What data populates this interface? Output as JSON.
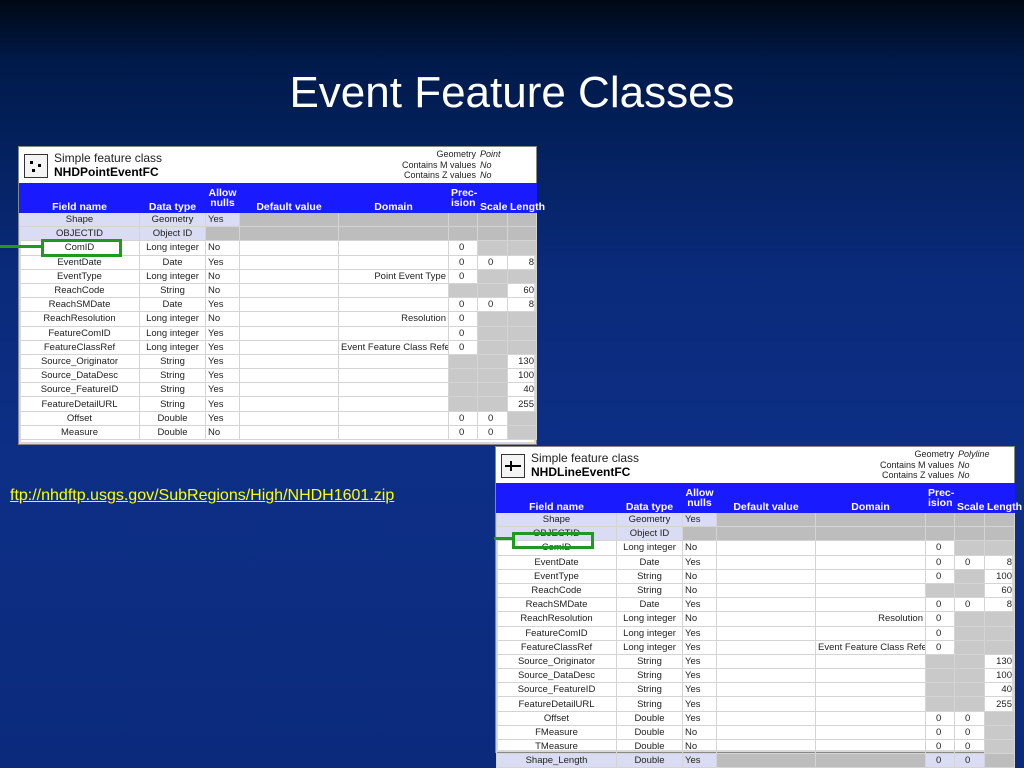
{
  "slide": {
    "title": "Event Feature Classes",
    "link": "ftp://nhdftp.usgs.gov/SubRegions/High/NHDH1601.zip"
  },
  "columns": [
    "Field name",
    "Data type",
    "Allow nulls",
    "Default value",
    "Domain",
    "Prec-ision",
    "Scale",
    "Length"
  ],
  "columns_display": {
    "field": "Field name",
    "type": "Data type",
    "nulls1": "Allow",
    "nulls2": "nulls",
    "default": "Default value",
    "domain": "Domain",
    "prec1": "Prec-",
    "prec2": "ision",
    "scale": "Scale",
    "length": "Length"
  },
  "point_fc": {
    "kind": "Simple feature class",
    "name": "NHDPointEventFC",
    "meta": [
      {
        "key": "Geometry",
        "value": "Point"
      },
      {
        "key": "Contains M values",
        "value": "No"
      },
      {
        "key": "Contains Z values",
        "value": "No"
      }
    ],
    "rows": [
      {
        "field": "Shape",
        "type": "Geometry",
        "nulls": "Yes",
        "default": "",
        "domain": "",
        "precision": "",
        "scale": "",
        "length": "",
        "sys": true
      },
      {
        "field": "OBJECTID",
        "type": "Object ID",
        "nulls": "",
        "default": "",
        "domain": "",
        "precision": "",
        "scale": "",
        "length": "",
        "sys": true
      },
      {
        "field": "ComID",
        "type": "Long integer",
        "nulls": "No",
        "default": "",
        "domain": "",
        "precision": "0",
        "scale": "",
        "length": ""
      },
      {
        "field": "EventDate",
        "type": "Date",
        "nulls": "Yes",
        "default": "",
        "domain": "",
        "precision": "0",
        "scale": "0",
        "length": "8"
      },
      {
        "field": "EventType",
        "type": "Long integer",
        "nulls": "No",
        "default": "",
        "domain": "Point Event Type",
        "precision": "0",
        "scale": "",
        "length": ""
      },
      {
        "field": "ReachCode",
        "type": "String",
        "nulls": "No",
        "default": "",
        "domain": "",
        "precision": "",
        "scale": "",
        "length": "60"
      },
      {
        "field": "ReachSMDate",
        "type": "Date",
        "nulls": "Yes",
        "default": "",
        "domain": "",
        "precision": "0",
        "scale": "0",
        "length": "8"
      },
      {
        "field": "ReachResolution",
        "type": "Long integer",
        "nulls": "No",
        "default": "",
        "domain": "Resolution",
        "precision": "0",
        "scale": "",
        "length": ""
      },
      {
        "field": "FeatureComID",
        "type": "Long integer",
        "nulls": "Yes",
        "default": "",
        "domain": "",
        "precision": "0",
        "scale": "",
        "length": ""
      },
      {
        "field": "FeatureClassRef",
        "type": "Long integer",
        "nulls": "Yes",
        "default": "",
        "domain": "Event Feature Class Reference",
        "precision": "0",
        "scale": "",
        "length": ""
      },
      {
        "field": "Source_Originator",
        "type": "String",
        "nulls": "Yes",
        "default": "",
        "domain": "",
        "precision": "",
        "scale": "",
        "length": "130"
      },
      {
        "field": "Source_DataDesc",
        "type": "String",
        "nulls": "Yes",
        "default": "",
        "domain": "",
        "precision": "",
        "scale": "",
        "length": "100"
      },
      {
        "field": "Source_FeatureID",
        "type": "String",
        "nulls": "Yes",
        "default": "",
        "domain": "",
        "precision": "",
        "scale": "",
        "length": "40"
      },
      {
        "field": "FeatureDetailURL",
        "type": "String",
        "nulls": "Yes",
        "default": "",
        "domain": "",
        "precision": "",
        "scale": "",
        "length": "255"
      },
      {
        "field": "Offset",
        "type": "Double",
        "nulls": "Yes",
        "default": "",
        "domain": "",
        "precision": "0",
        "scale": "0",
        "length": ""
      },
      {
        "field": "Measure",
        "type": "Double",
        "nulls": "No",
        "default": "",
        "domain": "",
        "precision": "0",
        "scale": "0",
        "length": ""
      }
    ]
  },
  "line_fc": {
    "kind": "Simple feature class",
    "name": "NHDLineEventFC",
    "meta": [
      {
        "key": "Geometry",
        "value": "Polyline"
      },
      {
        "key": "Contains M values",
        "value": "No"
      },
      {
        "key": "Contains Z values",
        "value": "No"
      }
    ],
    "rows": [
      {
        "field": "Shape",
        "type": "Geometry",
        "nulls": "Yes",
        "default": "",
        "domain": "",
        "precision": "",
        "scale": "",
        "length": "",
        "sys": true
      },
      {
        "field": "OBJECTID",
        "type": "Object ID",
        "nulls": "",
        "default": "",
        "domain": "",
        "precision": "",
        "scale": "",
        "length": "",
        "sys": true
      },
      {
        "field": "ComID",
        "type": "Long integer",
        "nulls": "No",
        "default": "",
        "domain": "",
        "precision": "0",
        "scale": "",
        "length": ""
      },
      {
        "field": "EventDate",
        "type": "Date",
        "nulls": "Yes",
        "default": "",
        "domain": "",
        "precision": "0",
        "scale": "0",
        "length": "8"
      },
      {
        "field": "EventType",
        "type": "String",
        "nulls": "No",
        "default": "",
        "domain": "",
        "precision": "0",
        "scale": "",
        "length": "100"
      },
      {
        "field": "ReachCode",
        "type": "String",
        "nulls": "No",
        "default": "",
        "domain": "",
        "precision": "",
        "scale": "",
        "length": "60"
      },
      {
        "field": "ReachSMDate",
        "type": "Date",
        "nulls": "Yes",
        "default": "",
        "domain": "",
        "precision": "0",
        "scale": "0",
        "length": "8"
      },
      {
        "field": "ReachResolution",
        "type": "Long integer",
        "nulls": "No",
        "default": "",
        "domain": "Resolution",
        "precision": "0",
        "scale": "",
        "length": ""
      },
      {
        "field": "FeatureComID",
        "type": "Long integer",
        "nulls": "Yes",
        "default": "",
        "domain": "",
        "precision": "0",
        "scale": "",
        "length": ""
      },
      {
        "field": "FeatureClassRef",
        "type": "Long integer",
        "nulls": "Yes",
        "default": "",
        "domain": "Event Feature Class Reference",
        "precision": "0",
        "scale": "",
        "length": ""
      },
      {
        "field": "Source_Originator",
        "type": "String",
        "nulls": "Yes",
        "default": "",
        "domain": "",
        "precision": "",
        "scale": "",
        "length": "130"
      },
      {
        "field": "Source_DataDesc",
        "type": "String",
        "nulls": "Yes",
        "default": "",
        "domain": "",
        "precision": "",
        "scale": "",
        "length": "100"
      },
      {
        "field": "Source_FeatureID",
        "type": "String",
        "nulls": "Yes",
        "default": "",
        "domain": "",
        "precision": "",
        "scale": "",
        "length": "40"
      },
      {
        "field": "FeatureDetailURL",
        "type": "String",
        "nulls": "Yes",
        "default": "",
        "domain": "",
        "precision": "",
        "scale": "",
        "length": "255"
      },
      {
        "field": "Offset",
        "type": "Double",
        "nulls": "Yes",
        "default": "",
        "domain": "",
        "precision": "0",
        "scale": "0",
        "length": ""
      },
      {
        "field": "FMeasure",
        "type": "Double",
        "nulls": "No",
        "default": "",
        "domain": "",
        "precision": "0",
        "scale": "0",
        "length": ""
      },
      {
        "field": "TMeasure",
        "type": "Double",
        "nulls": "No",
        "default": "",
        "domain": "",
        "precision": "0",
        "scale": "0",
        "length": ""
      },
      {
        "field": "Shape_Length",
        "type": "Double",
        "nulls": "Yes",
        "default": "",
        "domain": "",
        "precision": "0",
        "scale": "0",
        "length": "",
        "sys": true
      }
    ]
  },
  "highlight_color": "#1f9a1f"
}
